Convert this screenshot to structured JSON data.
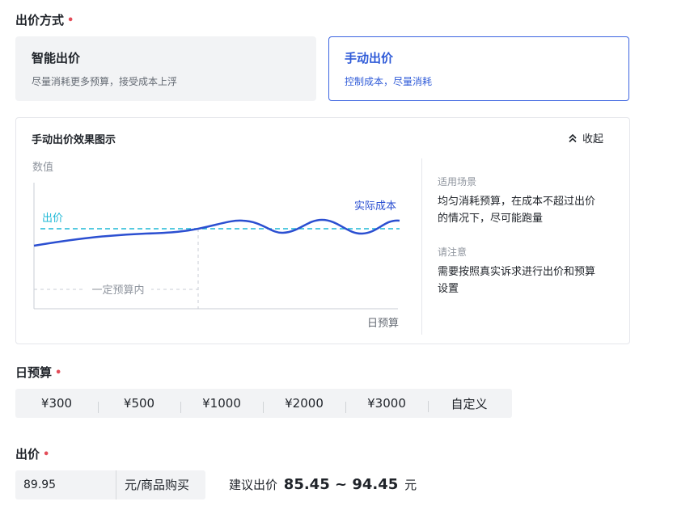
{
  "bid_method": {
    "title": "出价方式",
    "required_mark": "•",
    "smart": {
      "name": "智能出价",
      "desc": "尽量消耗更多预算，接受成本上浮"
    },
    "manual": {
      "name": "手动出价",
      "desc": "控制成本，尽量消耗"
    }
  },
  "effect_panel": {
    "title": "手动出价效果图示",
    "collapse_label": "收起",
    "chart": {
      "y_label": "数值",
      "x_label": "日预算",
      "bid_label": "出价",
      "actual_cost_label": "实际成本",
      "budget_label": "一定预算内"
    },
    "scenario_label": "适用场景",
    "scenario_text": "均匀消耗预算，在成本不超过出价的情况下，尽可能跑量",
    "note_label": "请注意",
    "note_text": "需要按照真实诉求进行出价和预算设置"
  },
  "daily_budget": {
    "title": "日预算",
    "required_mark": "•",
    "options": [
      "¥300",
      "¥500",
      "¥1000",
      "¥2000",
      "¥3000",
      "自定义"
    ]
  },
  "bid": {
    "title": "出价",
    "required_mark": "•",
    "value": "89.95",
    "unit": "元/商品购买",
    "suggest_prefix": "建议出价",
    "suggest_range": "85.45 ~ 94.45",
    "suggest_suffix": "元"
  },
  "colors": {
    "accent": "#2f5bd8",
    "bid_line": "#1fb8d6",
    "cost_line": "#2b4fd1",
    "required": "#e34d59"
  }
}
